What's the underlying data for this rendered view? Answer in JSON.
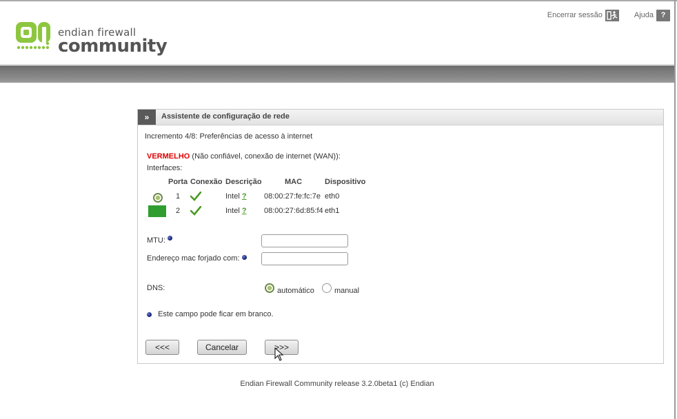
{
  "brand": {
    "line1": "endian firewall",
    "line2": "community",
    "accent": "#8dc63f"
  },
  "toplinks": {
    "logout_label": "Encerrar sessão",
    "help_label": "Ajuda",
    "help_icon_glyph": "?"
  },
  "panel": {
    "chevron": "»",
    "title": "Assistente de configuração de rede",
    "step": "Incremento 4/8: Preferências de acesso à internet",
    "zone_name": "VERMELHO",
    "zone_desc": " (Não confiável, conexão de internet (WAN)):",
    "interfaces_label": "Interfaces:",
    "table": {
      "headers": [
        "Porta",
        "Conexão",
        "Descrição",
        "MAC",
        "Dispositivo"
      ],
      "rows": [
        {
          "port": "1",
          "connection": "ok",
          "description": "Intel",
          "help": "?",
          "mac": "08:00:27:fe:fc:7e",
          "device": "eth0",
          "selector": "radio-selected"
        },
        {
          "port": "2",
          "connection": "ok",
          "description": "Intel",
          "help": "?",
          "mac": "08:00:27:6d:85:f4",
          "device": "eth1",
          "selector": "green-block"
        }
      ]
    },
    "mtu_label": "MTU:",
    "mtu_value": "",
    "mac_spoof_label": "Endereço mac forjado com:",
    "mac_spoof_value": "",
    "dns_label": "DNS:",
    "dns_options": [
      "automático",
      "manual"
    ],
    "dns_selected": "automático",
    "legend_text": "Este campo pode ficar em branco.",
    "buttons": {
      "back": "<<<",
      "cancel": "Cancelar",
      "next": ">>>"
    }
  },
  "footer": "Endian Firewall Community release 3.2.0beta1 (c) Endian",
  "colors": {
    "zone_red": "#e00000",
    "ok_green": "#4a9a23",
    "header_bar": "#7a7a7a"
  }
}
